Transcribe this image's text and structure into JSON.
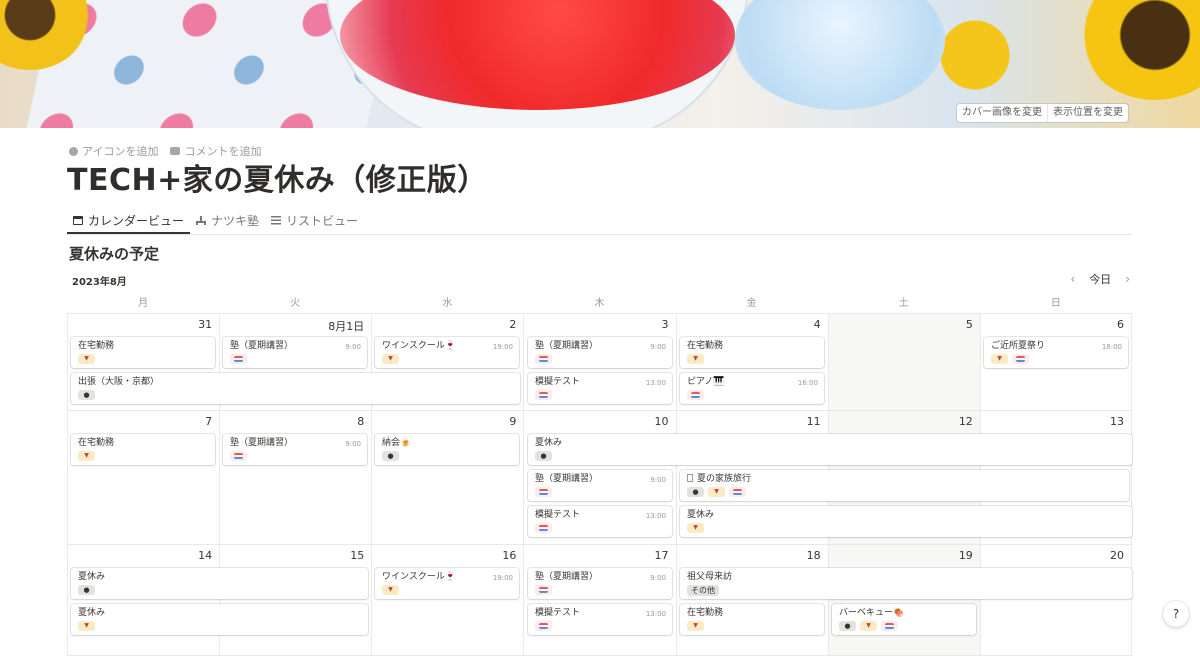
{
  "cover": {
    "change_cover": "カバー画像を変更",
    "reposition": "表示位置を変更"
  },
  "page_actions": {
    "add_icon": "アイコンを追加",
    "add_comment": "コメントを追加"
  },
  "title": "TECH+家の夏休み（修正版）",
  "tabs": [
    {
      "label": "カレンダービュー",
      "icon": "calendar-icon"
    },
    {
      "label": "ナツキ塾",
      "icon": "hierarchy-icon"
    },
    {
      "label": "リストビュー",
      "icon": "list-icon"
    }
  ],
  "section_title": "夏休みの予定",
  "month": "2023年8月",
  "nav": {
    "today": "今日",
    "prev": "‹",
    "next": "›"
  },
  "weekdays": [
    "月",
    "火",
    "水",
    "木",
    "金",
    "土",
    "日"
  ],
  "weeks": [
    {
      "days": [
        "31",
        "8月1日",
        "2",
        "3",
        "4",
        "5",
        "6"
      ]
    },
    {
      "days": [
        "7",
        "8",
        "9",
        "10",
        "11",
        "12",
        "13"
      ]
    },
    {
      "days": [
        "14",
        "15",
        "16",
        "17",
        "18",
        "19",
        "20"
      ]
    }
  ],
  "events": {
    "w1": {
      "remote_mon": {
        "title": "在宅勤務"
      },
      "juku_tue": {
        "title": "塾（夏期講習）",
        "time": "9:00"
      },
      "wine_wed": {
        "title": "ワインスクール🍷",
        "time": "19:00"
      },
      "juku_thu": {
        "title": "塾（夏期講習）",
        "time": "9:00"
      },
      "remote_fri": {
        "title": "在宅勤務"
      },
      "festival_sun": {
        "title": "ご近所夏祭り",
        "time": "18:00"
      },
      "trip": {
        "title": "出張（大阪・京都）"
      },
      "exam_thu": {
        "title": "模擬テスト",
        "time": "13:00"
      },
      "piano_fri": {
        "title": "ピアノ🎹",
        "time": "16:00"
      }
    },
    "w2": {
      "remote_mon": {
        "title": "在宅勤務"
      },
      "juku_tue": {
        "title": "塾（夏期講習）",
        "time": "9:00"
      },
      "nokai_wed": {
        "title": "納会🍺"
      },
      "vacation_long": {
        "title": "夏休み"
      },
      "juku_thu": {
        "title": "塾（夏期講習）",
        "time": "9:00"
      },
      "family_trip": {
        "title": "夏の家族旅行"
      },
      "exam_thu": {
        "title": "模擬テスト",
        "time": "13:00"
      },
      "vacation_fri": {
        "title": "夏休み"
      }
    },
    "w3": {
      "vacation_a": {
        "title": "夏休み"
      },
      "wine_wed": {
        "title": "ワインスクール🍷",
        "time": "19:00"
      },
      "juku_thu": {
        "title": "塾（夏期講習）",
        "time": "9:00"
      },
      "grandparents": {
        "title": "祖父母来訪",
        "tag": "その他"
      },
      "vacation_b": {
        "title": "夏休み"
      },
      "exam_thu": {
        "title": "模擬テスト",
        "time": "13:00"
      },
      "remote_fri": {
        "title": "在宅勤務"
      },
      "bbq_sat": {
        "title": "バーベキュー🍖"
      }
    }
  },
  "help": "?",
  "colors": {
    "accent_text": "#37352f",
    "muted_text": "#9b9a97",
    "weekend_bg": "#f7f7f5",
    "tag_cocktail_bg": "#fbeac6",
    "tag_ball_bg": "#e3e2e0",
    "tag_stripe_bg": "#fdebec"
  }
}
